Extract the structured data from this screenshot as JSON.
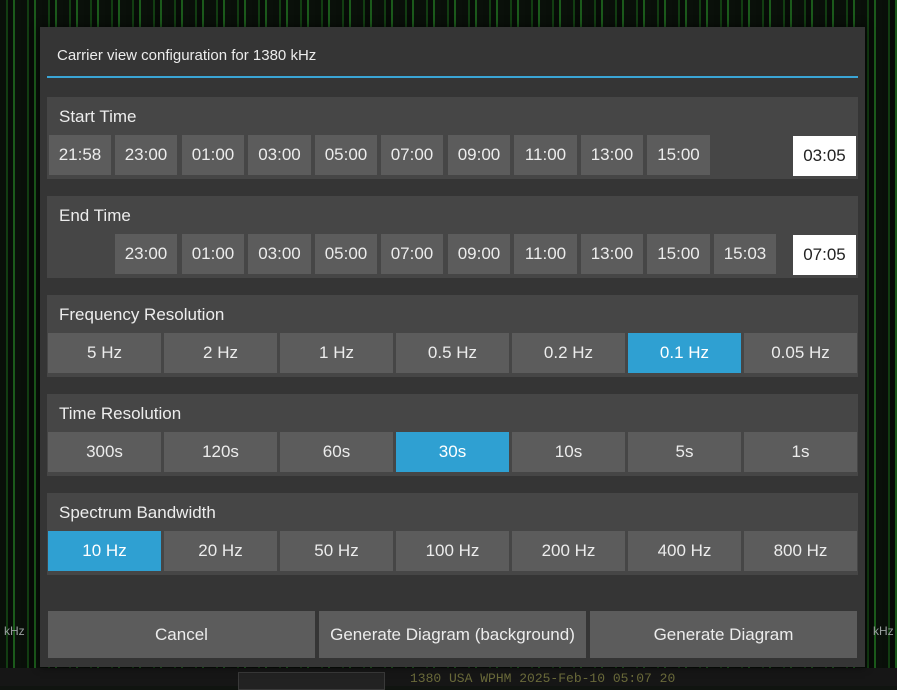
{
  "background": {
    "left_label": "kHz",
    "right_label": "kHz",
    "ticker": "1380        USA  WPHM  2025-Feb-10 05:07          20"
  },
  "dialog": {
    "title": "Carrier view configuration for 1380 kHz",
    "accent_color": "#2fa0d2",
    "sections": {
      "start_time": {
        "label": "Start Time",
        "options": [
          "21:58",
          "23:00",
          "01:00",
          "03:00",
          "05:00",
          "07:00",
          "09:00",
          "11:00",
          "13:00",
          "15:00"
        ],
        "current_value": "03:05"
      },
      "end_time": {
        "label": "End Time",
        "options": [
          "23:00",
          "01:00",
          "03:00",
          "05:00",
          "07:00",
          "09:00",
          "11:00",
          "13:00",
          "15:00",
          "15:03"
        ],
        "current_value": "07:05"
      },
      "frequency_resolution": {
        "label": "Frequency Resolution",
        "options": [
          "5 Hz",
          "2 Hz",
          "1 Hz",
          "0.5 Hz",
          "0.2 Hz",
          "0.1 Hz",
          "0.05 Hz"
        ],
        "selected": "0.1 Hz"
      },
      "time_resolution": {
        "label": "Time Resolution",
        "options": [
          "300s",
          "120s",
          "60s",
          "30s",
          "10s",
          "5s",
          "1s"
        ],
        "selected": "30s"
      },
      "spectrum_bandwidth": {
        "label": "Spectrum Bandwidth",
        "options": [
          "10 Hz",
          "20 Hz",
          "50 Hz",
          "100 Hz",
          "200 Hz",
          "400 Hz",
          "800 Hz"
        ],
        "selected": "10 Hz"
      }
    },
    "actions": {
      "cancel": "Cancel",
      "generate_background": "Generate Diagram (background)",
      "generate": "Generate Diagram"
    }
  }
}
